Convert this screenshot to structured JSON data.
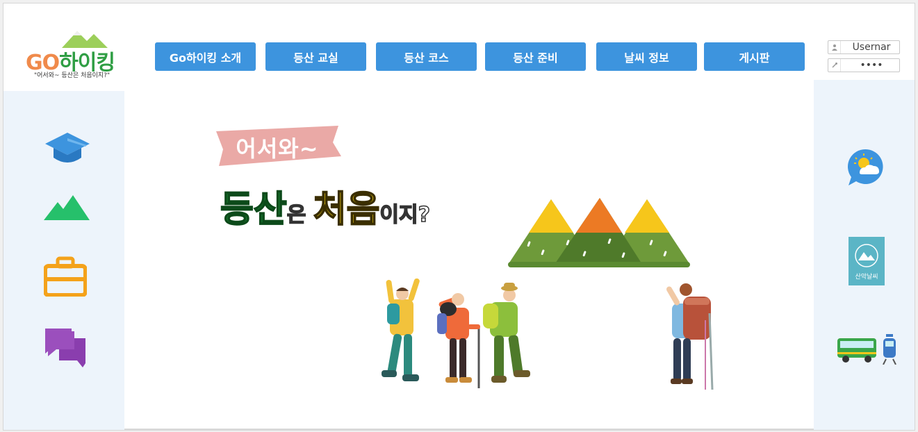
{
  "logo": {
    "brand_go": "GO",
    "brand_korean": "하이킹",
    "tagline": "\"어서와~ 등산은 처음이지?\""
  },
  "nav": {
    "items": [
      "Go하이킹 소개",
      "등산 교실",
      "등산 코스",
      "등산 준비",
      "날씨 정보",
      "게시판"
    ]
  },
  "login": {
    "username_value": "Usernar",
    "password_value": "••••"
  },
  "left_sidebar": {
    "icons": [
      "graduation-cap-icon",
      "mountain-icon",
      "briefcase-icon",
      "chat-bubbles-icon"
    ]
  },
  "right_sidebar": {
    "icons": [
      "weather-chat-icon",
      "mountain-weather-badge-icon",
      "bus-train-icon"
    ],
    "badge_text": "산악날씨"
  },
  "hero": {
    "welcome": "어서와~",
    "headline_part1": "등산",
    "headline_part2": "은 ",
    "headline_part3": "처음",
    "headline_part4": "이지?"
  },
  "colors": {
    "nav_blue": "#3d94de",
    "side_bg": "#edf4fb",
    "welcome_pink": "#eaa9a6",
    "headline_green": "#1c9a3a",
    "headline_yellow": "#f6d21b"
  }
}
